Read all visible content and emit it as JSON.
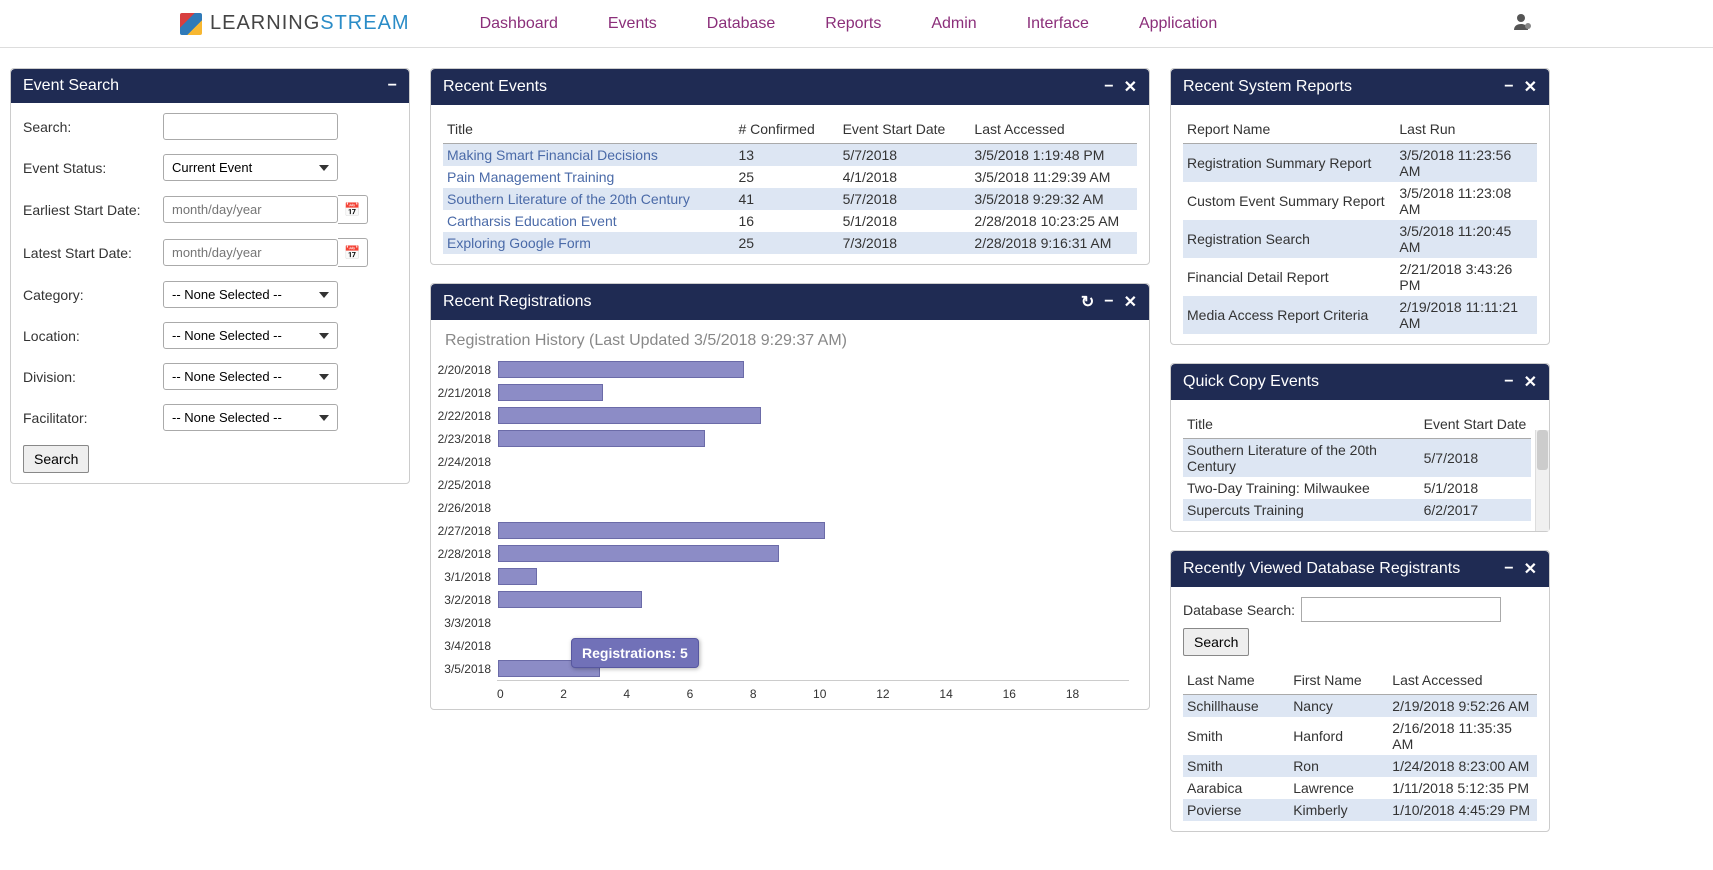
{
  "brand": {
    "part1": "LEARNING",
    "part2": "STREAM"
  },
  "nav": [
    "Dashboard",
    "Events",
    "Database",
    "Reports",
    "Admin",
    "Interface",
    "Application"
  ],
  "eventSearch": {
    "title": "Event Search",
    "labels": {
      "search": "Search:",
      "status": "Event Status:",
      "earliest": "Earliest Start Date:",
      "latest": "Latest Start Date:",
      "category": "Category:",
      "location": "Location:",
      "division": "Division:",
      "facilitator": "Facilitator:"
    },
    "statusValue": "Current Event",
    "dateText": "month/day/year",
    "noneSelected": "-- None Selected --",
    "searchBtn": "Search"
  },
  "recentEvents": {
    "title": "Recent Events",
    "headers": [
      "Title",
      "# Confirmed",
      "Event Start Date",
      "Last Accessed"
    ],
    "rows": [
      {
        "title": "Making Smart Financial Decisions",
        "confirmed": "13",
        "start": "5/7/2018",
        "accessed": "3/5/2018 1:19:48 PM"
      },
      {
        "title": "Pain Management Training",
        "confirmed": "25",
        "start": "4/1/2018",
        "accessed": "3/5/2018 11:29:39 AM"
      },
      {
        "title": "Southern Literature of the 20th Century",
        "confirmed": "41",
        "start": "5/7/2018",
        "accessed": "3/5/2018 9:29:32 AM"
      },
      {
        "title": "Cartharsis Education Event",
        "confirmed": "16",
        "start": "5/1/2018",
        "accessed": "2/28/2018 10:23:25 AM"
      },
      {
        "title": "Exploring Google Form",
        "confirmed": "25",
        "start": "7/3/2018",
        "accessed": "2/28/2018 9:16:31 AM"
      }
    ]
  },
  "recentRegistrations": {
    "title": "Recent Registrations",
    "chartTitle": "Registration History (Last Updated 3/5/2018 9:29:37 AM)",
    "tooltip": "Registrations: 5"
  },
  "chart_data": {
    "type": "bar",
    "orientation": "horizontal",
    "title": "Registration History (Last Updated 3/5/2018 9:29:37 AM)",
    "xlabel": "",
    "ylabel": "",
    "xlim": [
      0,
      18
    ],
    "xticks": [
      0,
      2,
      4,
      6,
      8,
      10,
      12,
      14,
      16,
      18
    ],
    "categories": [
      "2/20/2018",
      "2/21/2018",
      "2/22/2018",
      "2/23/2018",
      "2/24/2018",
      "2/25/2018",
      "2/26/2018",
      "2/27/2018",
      "2/28/2018",
      "3/1/2018",
      "3/2/2018",
      "3/3/2018",
      "3/4/2018",
      "3/5/2018"
    ],
    "values": [
      7.0,
      3.0,
      7.5,
      5.9,
      0,
      0,
      0,
      9.3,
      8.0,
      1.1,
      4.1,
      0,
      0,
      2.9
    ]
  },
  "recentReports": {
    "title": "Recent System Reports",
    "headers": [
      "Report Name",
      "Last Run"
    ],
    "rows": [
      {
        "name": "Registration Summary Report",
        "run": "3/5/2018 11:23:56 AM"
      },
      {
        "name": "Custom Event Summary Report",
        "run": "3/5/2018 11:23:08 AM"
      },
      {
        "name": "Registration Search",
        "run": "3/5/2018 11:20:45 AM"
      },
      {
        "name": "Financial Detail Report",
        "run": "2/21/2018 3:43:26 PM"
      },
      {
        "name": "Media Access Report Criteria",
        "run": "2/19/2018 11:11:21 AM"
      }
    ]
  },
  "quickCopy": {
    "title": "Quick Copy Events",
    "headers": [
      "Title",
      "Event Start Date"
    ],
    "rows": [
      {
        "title": "Southern Literature of the 20th Century",
        "start": "5/7/2018"
      },
      {
        "title": "Two-Day Training: Milwaukee",
        "start": "5/1/2018"
      },
      {
        "title": "Supercuts Training",
        "start": "6/2/2017"
      }
    ]
  },
  "dbRegistrants": {
    "title": "Recently Viewed Database Registrants",
    "searchLabel": "Database Search:",
    "searchBtn": "Search",
    "headers": [
      "Last Name",
      "First Name",
      "Last Accessed"
    ],
    "rows": [
      {
        "last": "Schillhause",
        "first": "Nancy",
        "accessed": "2/19/2018 9:52:26 AM"
      },
      {
        "last": "Smith",
        "first": "Hanford",
        "accessed": "2/16/2018 11:35:35 AM"
      },
      {
        "last": "Smith",
        "first": "Ron",
        "accessed": "1/24/2018 8:23:00 AM"
      },
      {
        "last": "Aarabica",
        "first": "Lawrence",
        "accessed": "1/11/2018 5:12:35 PM"
      },
      {
        "last": "Povierse",
        "first": "Kimberly",
        "accessed": "1/10/2018 4:45:29 PM"
      }
    ]
  }
}
